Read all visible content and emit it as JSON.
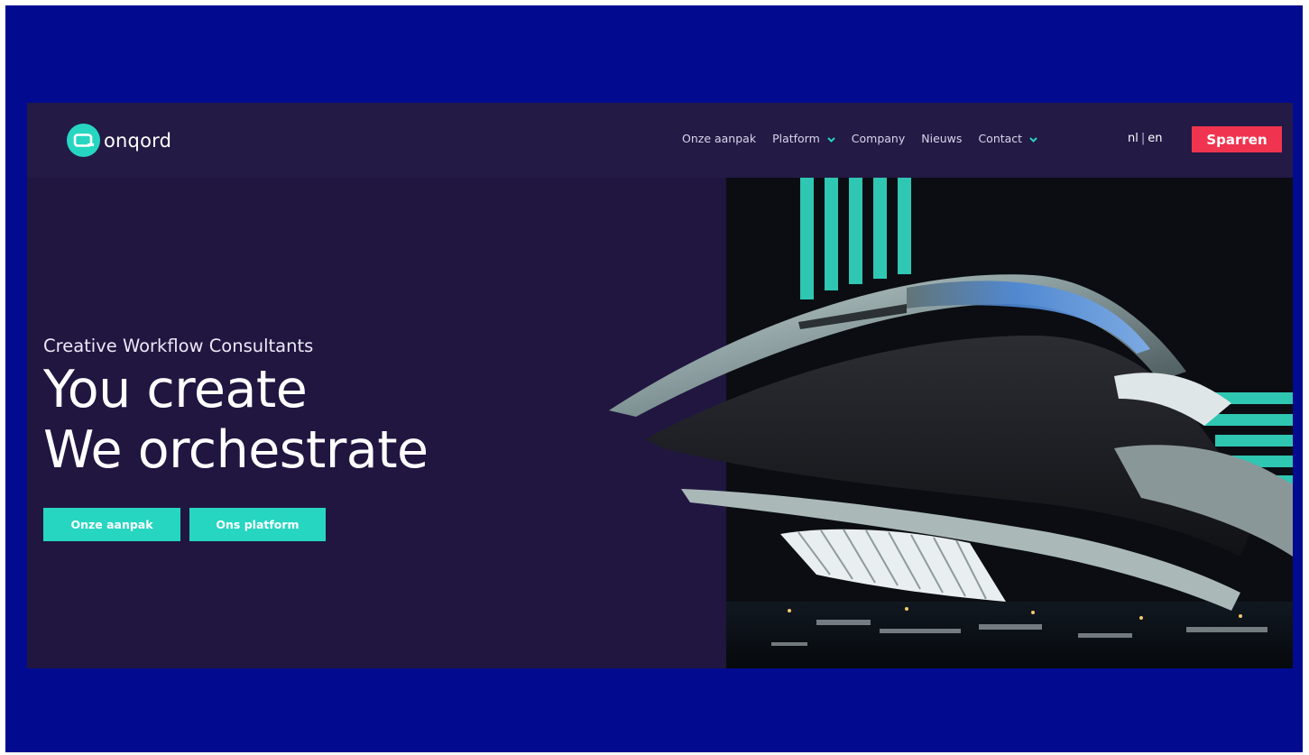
{
  "brand": {
    "name": "onqord",
    "logo_icon": "q-logo-icon",
    "accent": "#27d6c1"
  },
  "nav": {
    "items": [
      {
        "label": "Onze aanpak",
        "dropdown": false
      },
      {
        "label": "Platform",
        "dropdown": true
      },
      {
        "label": "Company",
        "dropdown": false
      },
      {
        "label": "Nieuws",
        "dropdown": false
      },
      {
        "label": "Contact",
        "dropdown": true
      }
    ],
    "lang": {
      "nl": "nl",
      "en": "en"
    },
    "cta_label": "Sparren",
    "cta_color": "#f0344f"
  },
  "hero": {
    "eyebrow": "Creative Workflow Consultants",
    "headline_line1": "You create",
    "headline_line2": "We orchestrate",
    "buttons": [
      {
        "label": "Onze aanpak"
      },
      {
        "label": "Ons platform"
      }
    ]
  },
  "colors": {
    "frame": "#020b8f",
    "background": "#201640",
    "navbar": "#231a45"
  }
}
